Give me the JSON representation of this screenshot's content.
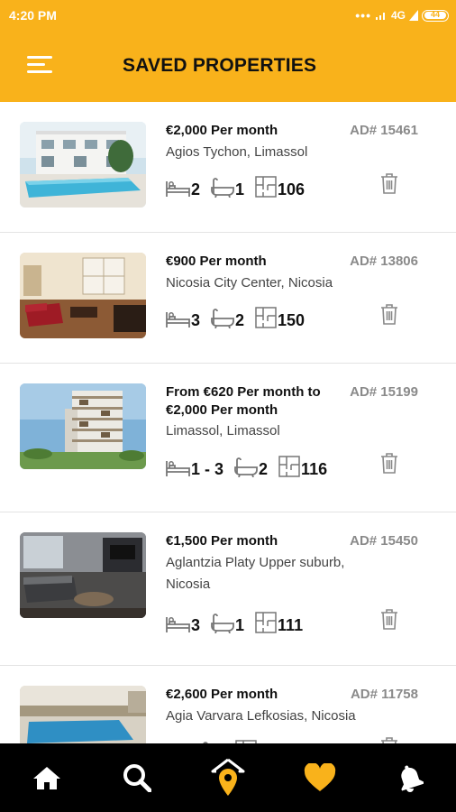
{
  "status_bar": {
    "time": "4:20 PM",
    "signal_dots": "•••",
    "network": "4G",
    "battery": "44"
  },
  "header": {
    "title": "SAVED PROPERTIES",
    "menu_icon": "hamburger-menu-icon"
  },
  "colors": {
    "accent": "#f9b21b",
    "nav_bg": "#000000",
    "active_nav": "#f9b21b"
  },
  "properties": [
    {
      "price": "€2,000 Per month",
      "ad": "AD# 15461",
      "location": "Agios Tychon, Limassol",
      "beds": "2",
      "baths": "1",
      "area": "106"
    },
    {
      "price": "€900 Per month",
      "ad": "AD# 13806",
      "location": "Nicosia City Center, Nicosia",
      "beds": "3",
      "baths": "2",
      "area": "150"
    },
    {
      "price": "From €620 Per month to €2,000 Per month",
      "ad": "AD# 15199",
      "location": "Limassol, Limassol",
      "beds": "1 - 3",
      "baths": "2",
      "area": "116"
    },
    {
      "price": "€1,500 Per month",
      "ad": "AD# 15450",
      "location": "Aglantzia Platy Upper suburb, Nicosia",
      "beds": "3",
      "baths": "1",
      "area": "111"
    },
    {
      "price": "€2,600 Per month",
      "ad": "AD# 11758",
      "location": "Agia Varvara Lefkosias, Nicosia",
      "beds": "",
      "baths": "",
      "area": ""
    }
  ],
  "bottom_nav": [
    {
      "name": "home",
      "icon": "home-icon"
    },
    {
      "name": "search",
      "icon": "search-icon"
    },
    {
      "name": "nearby",
      "icon": "home-location-icon"
    },
    {
      "name": "saved",
      "icon": "heart-icon",
      "active": true
    },
    {
      "name": "alerts",
      "icon": "bell-icon"
    }
  ]
}
